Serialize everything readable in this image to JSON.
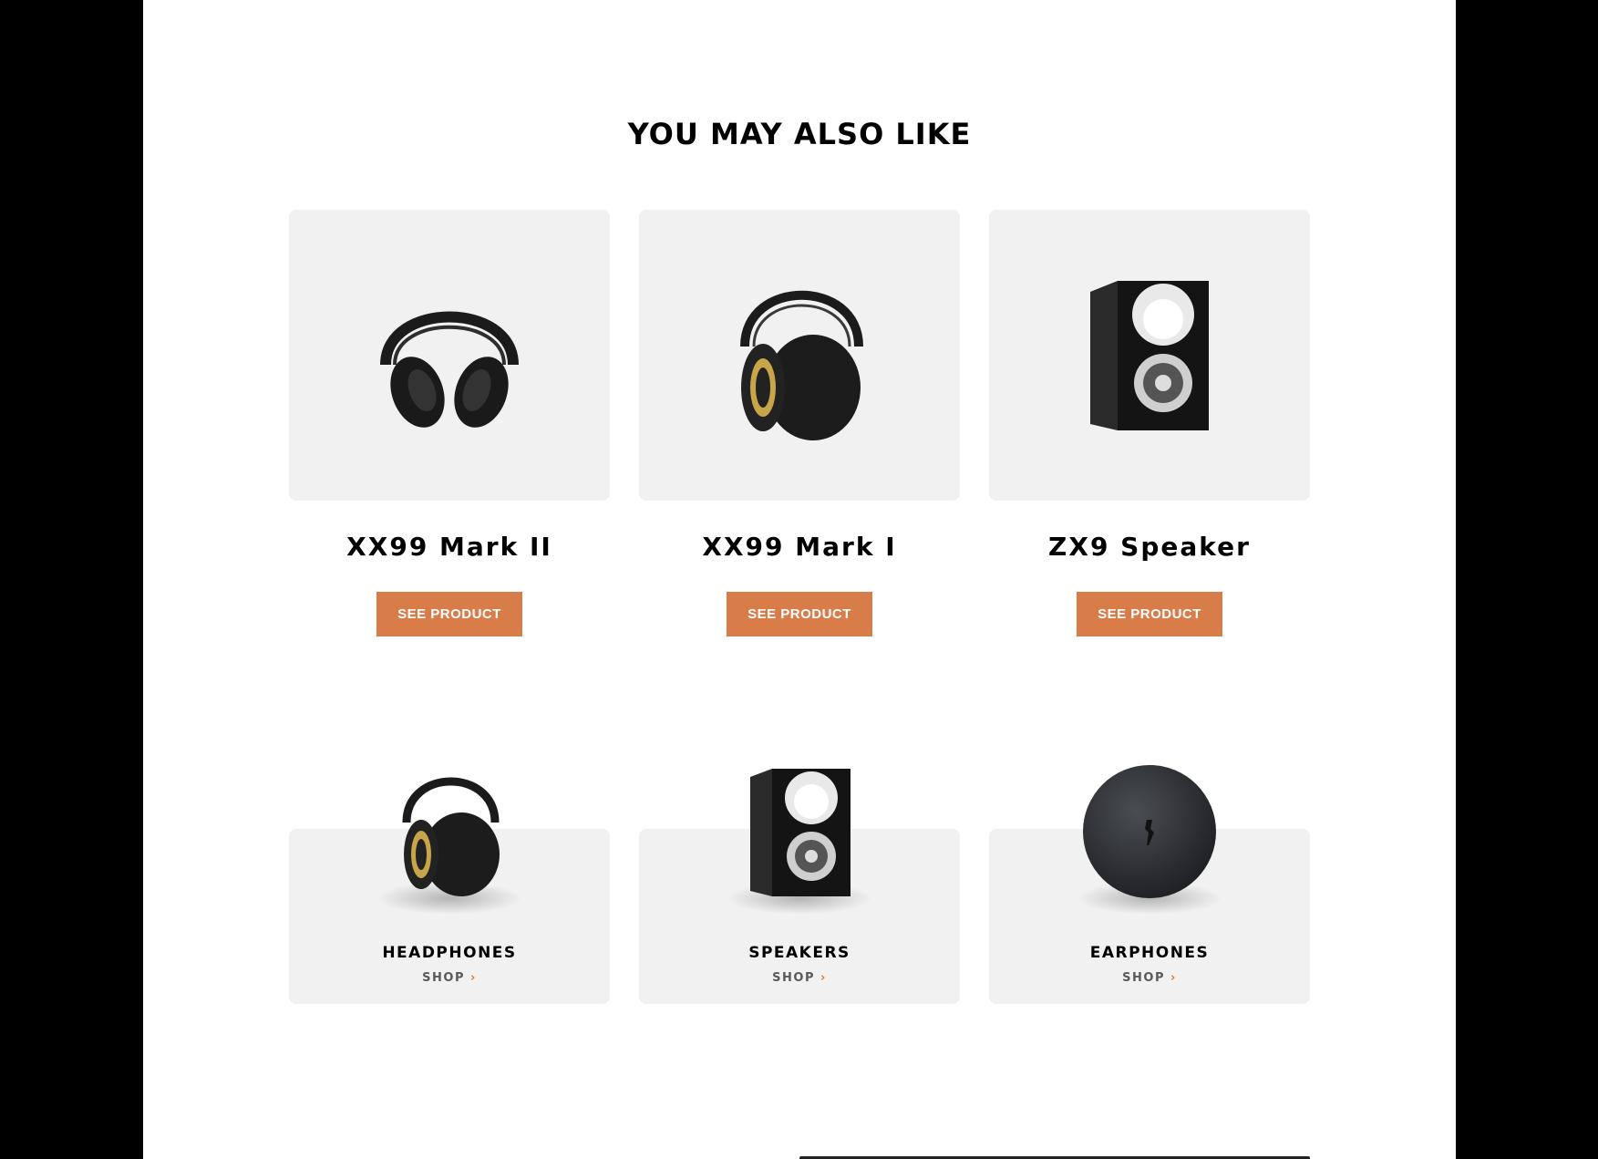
{
  "section": {
    "title": "YOU MAY ALSO LIKE"
  },
  "products": [
    {
      "name": "XX99 Mark II",
      "button": "SEE PRODUCT",
      "icon": "headphones-closed-icon"
    },
    {
      "name": "XX99 Mark I",
      "button": "SEE PRODUCT",
      "icon": "headphones-studio-icon"
    },
    {
      "name": "ZX9 Speaker",
      "button": "SEE PRODUCT",
      "icon": "speaker-icon"
    }
  ],
  "categories": [
    {
      "name": "HEADPHONES",
      "link": "SHOP",
      "arrow": "›",
      "icon": "headphones-icon"
    },
    {
      "name": "SPEAKERS",
      "link": "SHOP",
      "arrow": "›",
      "icon": "speaker-icon"
    },
    {
      "name": "EARPHONES",
      "link": "SHOP",
      "arrow": "›",
      "icon": "earphones-case-icon"
    }
  ],
  "colors": {
    "accent": "#d87d4a",
    "card_bg": "#f1f1f1",
    "text": "#000000"
  }
}
